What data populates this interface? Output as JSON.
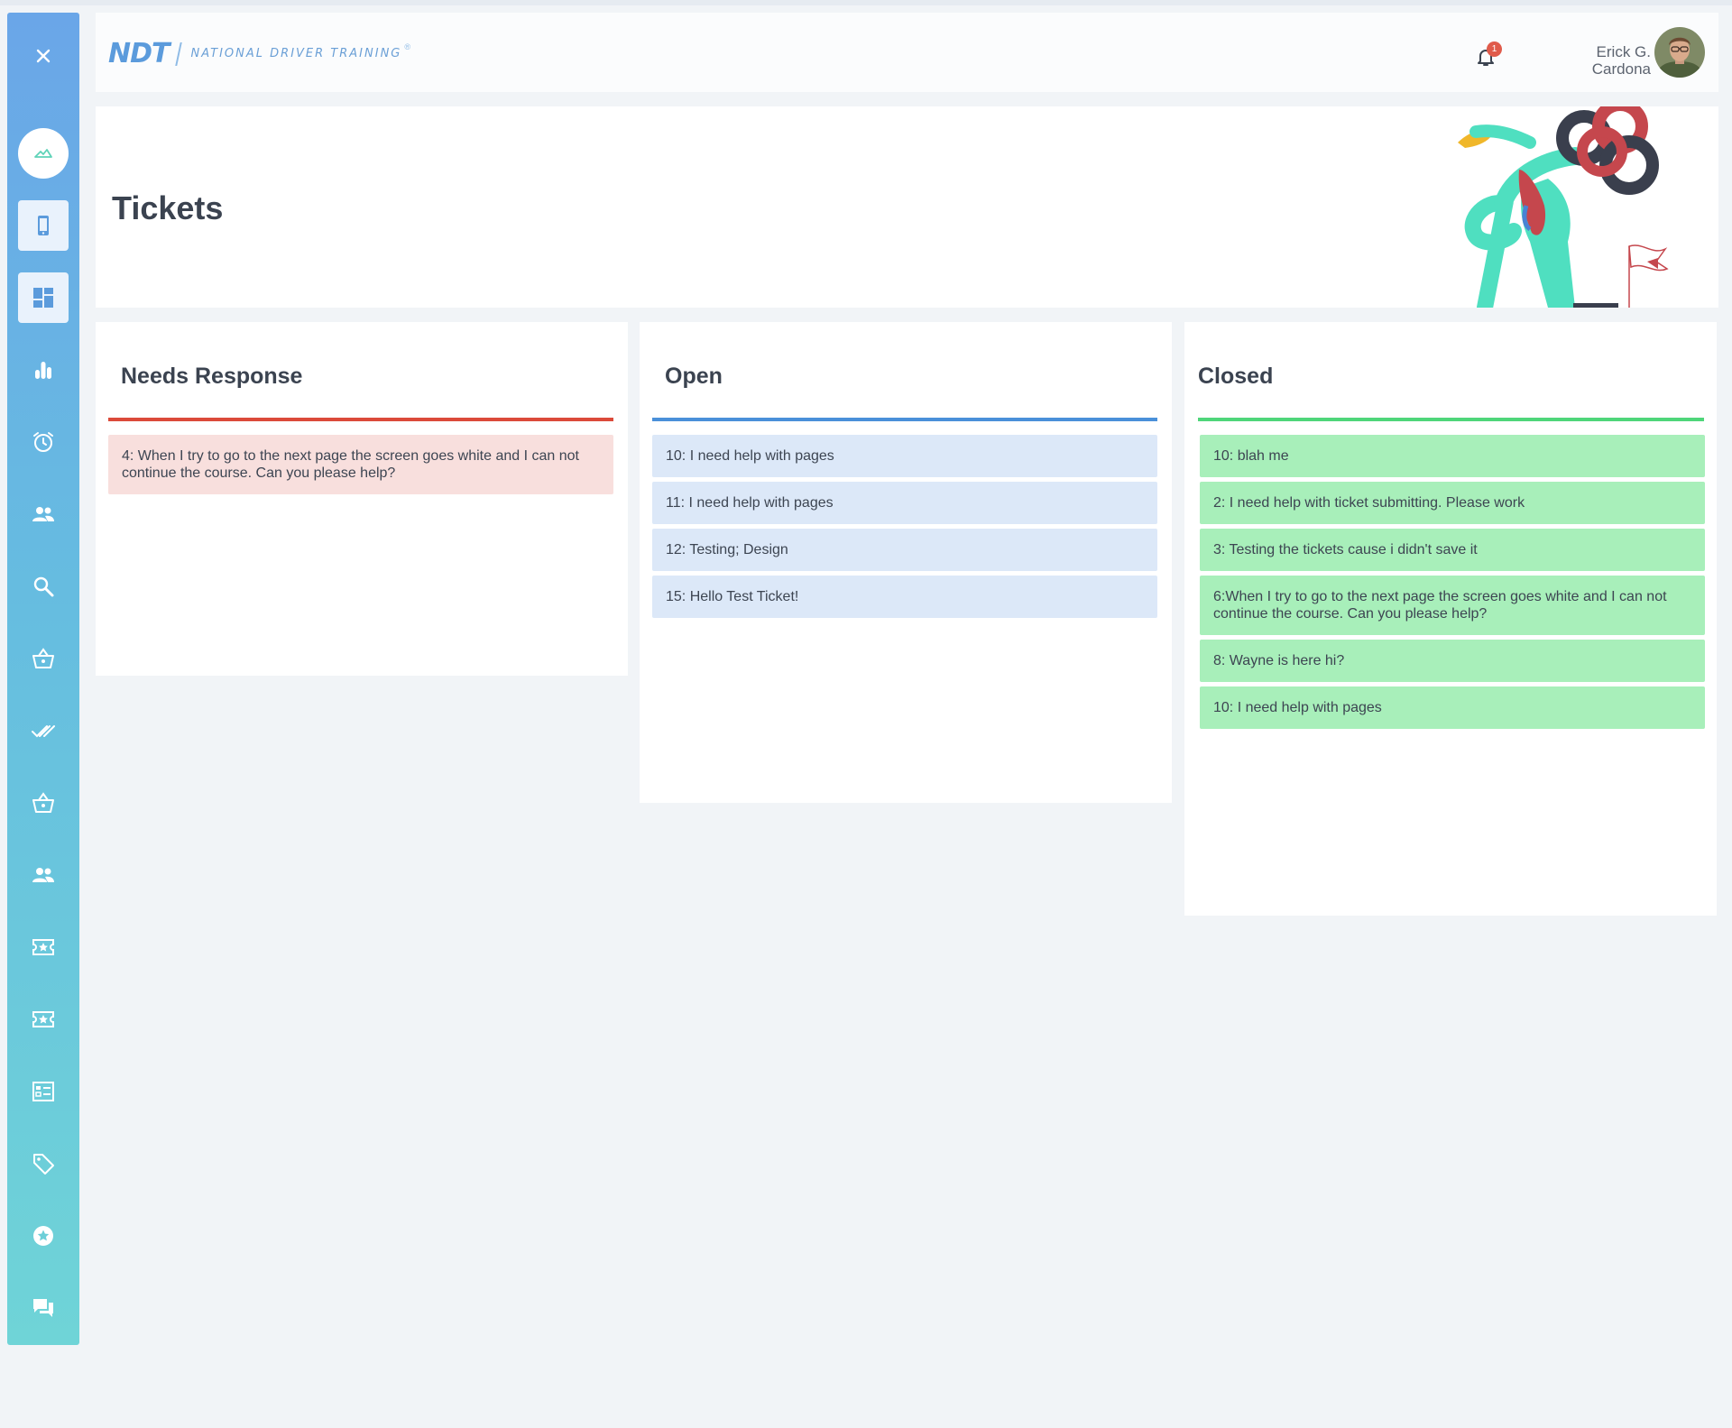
{
  "app": {
    "name": "NDT",
    "tagline": "NATIONAL DRIVER TRAINING",
    "reg": "®"
  },
  "colors": {
    "needs_response": "#db4a3a",
    "open": "#4a90d9",
    "closed": "#4fd67a",
    "needs_response_bg": "#f8dfdd",
    "open_bg": "#dce8f8",
    "closed_bg": "#a8efba"
  },
  "sidebar": {
    "items": [
      {
        "icon": "close-icon"
      },
      {
        "icon": "home-icon"
      },
      {
        "icon": "mobile-icon"
      },
      {
        "icon": "dashboard-icon"
      },
      {
        "icon": "bar-chart-icon"
      },
      {
        "icon": "alarm-icon"
      },
      {
        "icon": "users-icon"
      },
      {
        "icon": "search-icon"
      },
      {
        "icon": "basket-icon"
      },
      {
        "icon": "double-check-icon"
      },
      {
        "icon": "basket-icon"
      },
      {
        "icon": "users-icon"
      },
      {
        "icon": "ticket-star-icon"
      },
      {
        "icon": "ticket-star-icon"
      },
      {
        "icon": "checklist-icon"
      },
      {
        "icon": "tag-icon"
      },
      {
        "icon": "star-circle-icon"
      },
      {
        "icon": "chat-icon"
      }
    ]
  },
  "header": {
    "notifications_count": "1",
    "user_first": "Erick G.",
    "user_last": "Cardona"
  },
  "page": {
    "title": "Tickets"
  },
  "columns": {
    "needs_response": {
      "title": "Needs Response",
      "tickets": [
        "4: When I try to go to the next page the screen goes white and I can not continue the course. Can you please help?"
      ]
    },
    "open": {
      "title": "Open",
      "tickets": [
        "10: I need help with pages",
        "11: I need help with pages",
        "12: Testing; Design",
        "15: Hello Test Ticket!"
      ]
    },
    "closed": {
      "title": "Closed",
      "tickets": [
        "10: blah me",
        "2: I need help with ticket submitting. Please work",
        "3: Testing the tickets cause i didn't save it",
        "6:When I try to go to the next page the screen goes white and I can not continue the course. Can you please help?",
        "8: Wayne is here hi?",
        "10: I need help with pages"
      ]
    }
  }
}
